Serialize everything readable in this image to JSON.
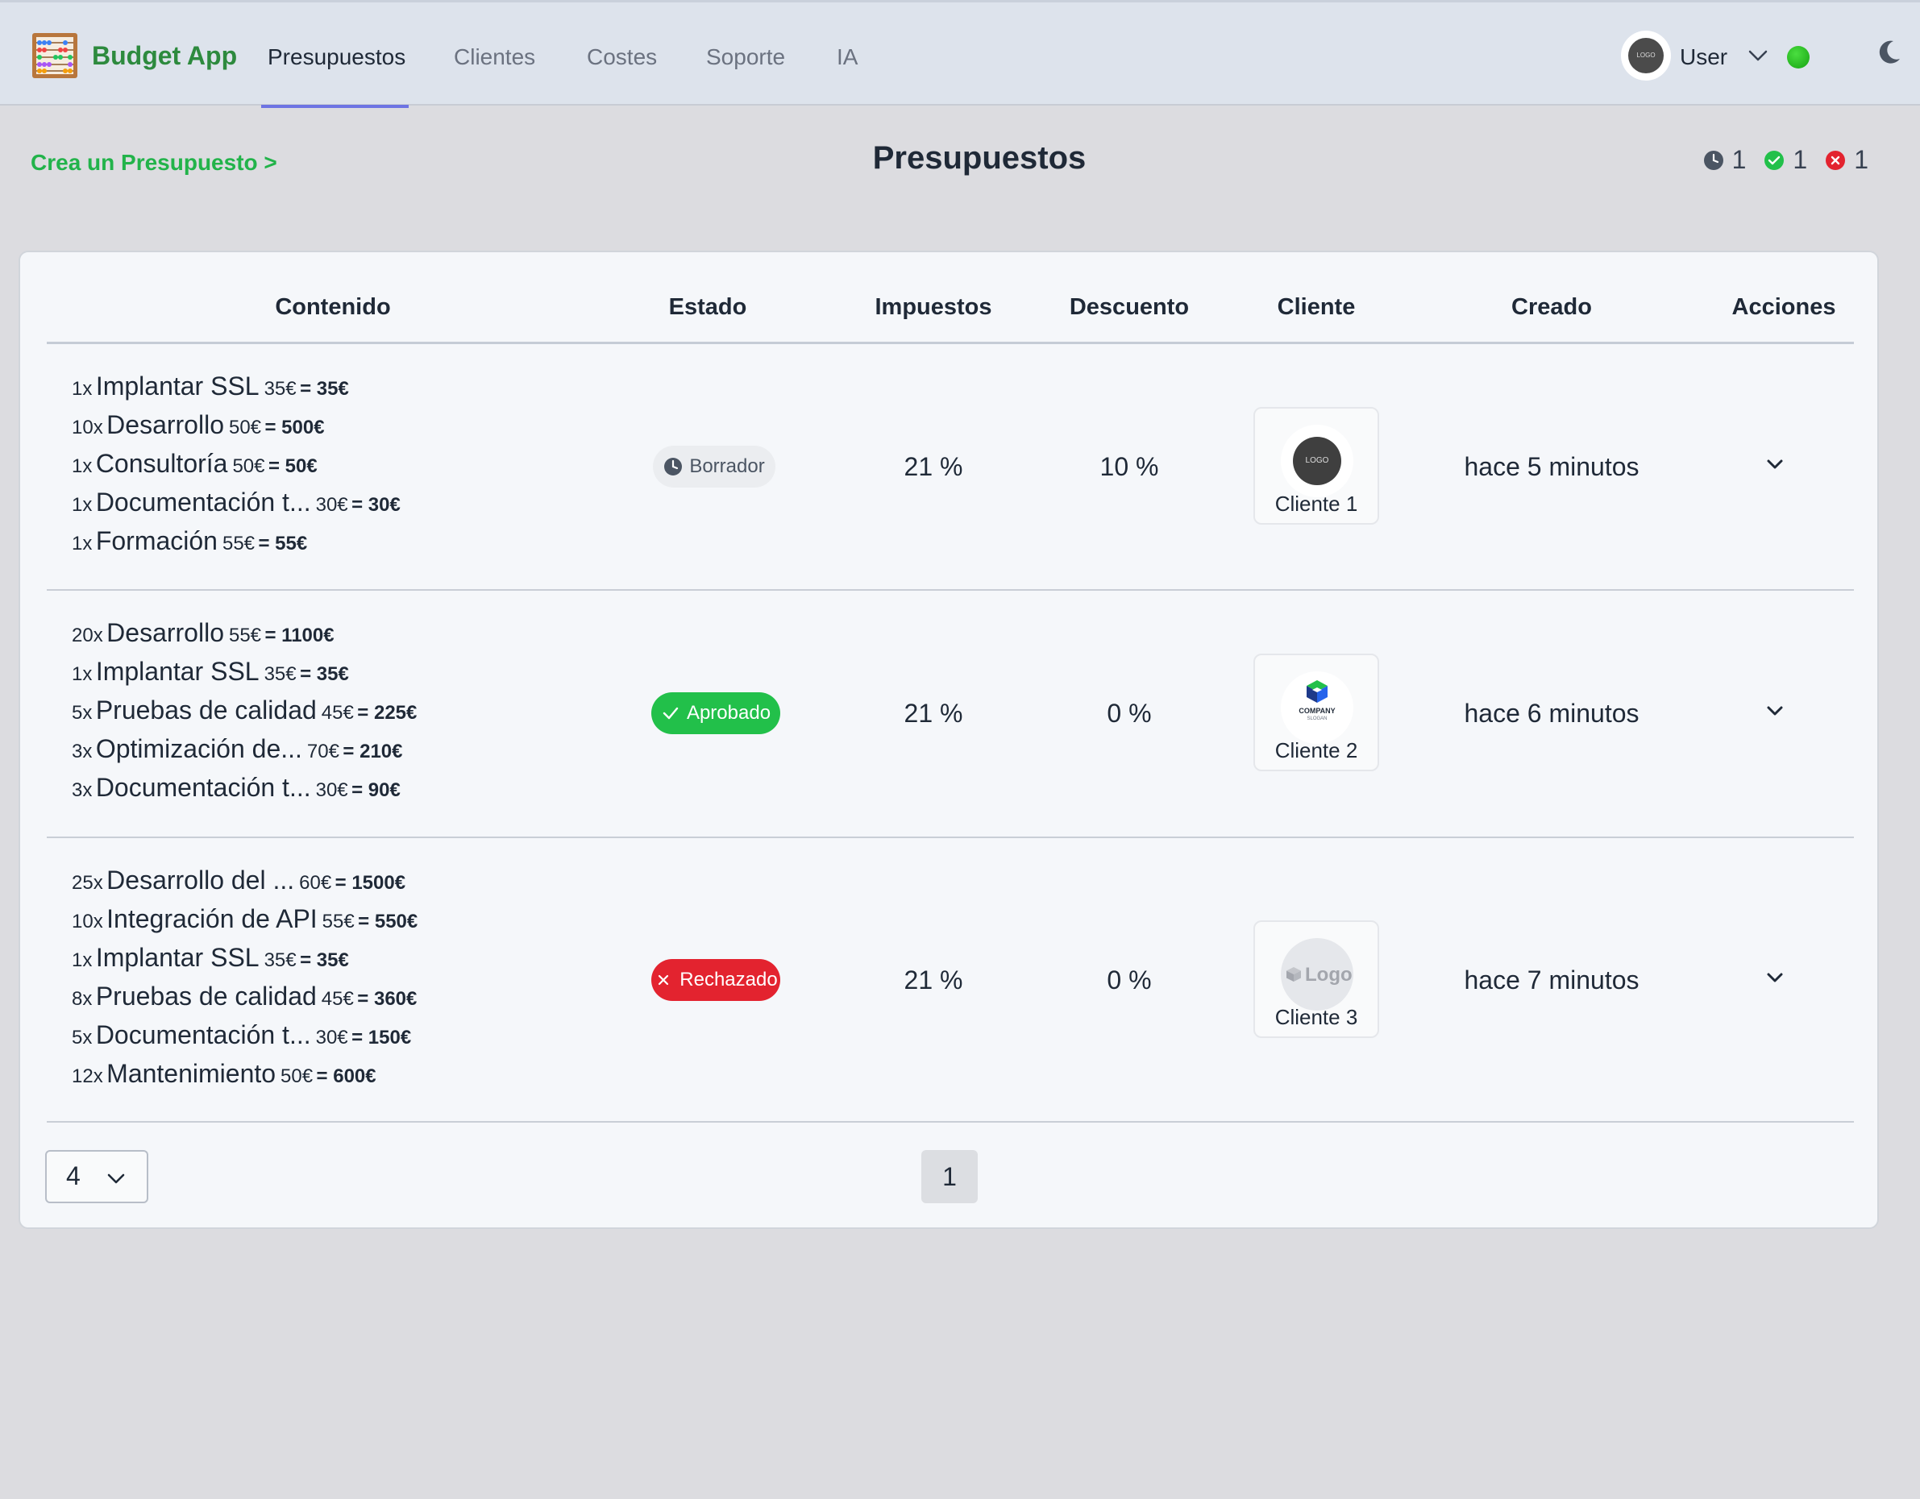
{
  "app": {
    "name": "Budget App",
    "nav": [
      "Presupuestos",
      "Clientes",
      "Costes",
      "Soporte",
      "IA"
    ],
    "user": {
      "name": "User",
      "avatar_text": "LOGO"
    }
  },
  "page": {
    "create_link": "Crea un Presupuesto >",
    "title": "Presupuestos",
    "counters": {
      "draft": "1",
      "approved": "1",
      "rejected": "1"
    }
  },
  "table": {
    "headers": {
      "content": "Contenido",
      "status": "Estado",
      "taxes": "Impuestos",
      "discount": "Descuento",
      "client": "Cliente",
      "created": "Creado",
      "actions": "Acciones"
    },
    "rows": [
      {
        "items": [
          {
            "qty": "1x",
            "name": "Implantar SSL",
            "price": "35€",
            "total": "= 35€"
          },
          {
            "qty": "10x",
            "name": "Desarrollo",
            "price": "50€",
            "total": "= 500€"
          },
          {
            "qty": "1x",
            "name": "Consultoría",
            "price": "50€",
            "total": "= 50€"
          },
          {
            "qty": "1x",
            "name": "Documentación t...",
            "price": "30€",
            "total": "= 30€"
          },
          {
            "qty": "1x",
            "name": "Formación",
            "price": "55€",
            "total": "= 55€"
          }
        ],
        "status": "Borrador",
        "taxes": "21 %",
        "discount": "10 %",
        "client": "Cliente 1",
        "client_logo_text": "LOGO",
        "created": "hace 5 minutos"
      },
      {
        "items": [
          {
            "qty": "20x",
            "name": "Desarrollo",
            "price": "55€",
            "total": "= 1100€"
          },
          {
            "qty": "1x",
            "name": "Implantar SSL",
            "price": "35€",
            "total": "= 35€"
          },
          {
            "qty": "5x",
            "name": "Pruebas de calidad",
            "price": "45€",
            "total": "= 225€"
          },
          {
            "qty": "3x",
            "name": "Optimización de...",
            "price": "70€",
            "total": "= 210€"
          },
          {
            "qty": "3x",
            "name": "Documentación t...",
            "price": "30€",
            "total": "= 90€"
          }
        ],
        "status": "Aprobado",
        "taxes": "21 %",
        "discount": "0 %",
        "client": "Cliente 2",
        "client_logo_text": "COMPANY",
        "client_logo_subtext": "SLOGAN",
        "created": "hace 6 minutos"
      },
      {
        "items": [
          {
            "qty": "25x",
            "name": "Desarrollo del ...",
            "price": "60€",
            "total": "= 1500€"
          },
          {
            "qty": "10x",
            "name": "Integración de API",
            "price": "55€",
            "total": "= 550€"
          },
          {
            "qty": "1x",
            "name": "Implantar SSL",
            "price": "35€",
            "total": "= 35€"
          },
          {
            "qty": "8x",
            "name": "Pruebas de calidad",
            "price": "45€",
            "total": "= 360€"
          },
          {
            "qty": "5x",
            "name": "Documentación t...",
            "price": "30€",
            "total": "= 150€"
          },
          {
            "qty": "12x",
            "name": "Mantenimiento",
            "price": "50€",
            "total": "= 600€"
          }
        ],
        "status": "Rechazado",
        "taxes": "21 %",
        "discount": "0 %",
        "client": "Cliente 3",
        "client_logo_text": "Logo",
        "created": "hace 7 minutos"
      }
    ]
  },
  "pagination": {
    "page_size": "4",
    "current_page": "1"
  },
  "colors": {
    "brand": "#2d8a3e",
    "accent": "#6d74e3",
    "link": "#22b34a",
    "approved": "#22c04a",
    "rejected": "#e3232f",
    "draft": "#ebedf0"
  }
}
